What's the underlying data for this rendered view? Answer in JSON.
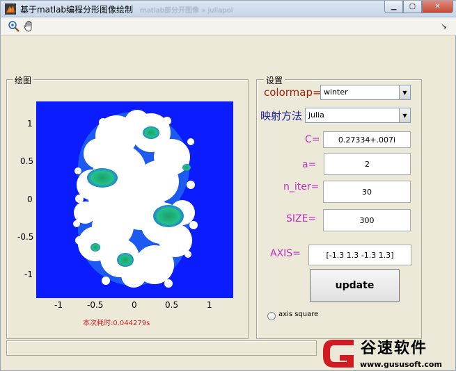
{
  "window": {
    "title": "基于matlab编程分形图像绘制",
    "title_ghost": "matlab部分开图像 » juliapol"
  },
  "toolbar": {
    "zoom_icon": "zoom-in-icon",
    "pan_icon": "pan-hand-icon",
    "dock_arrow": "↘"
  },
  "panels": {
    "plot_title": "绘图",
    "settings_title": "设置"
  },
  "plot": {
    "yticks": [
      "1",
      "0.5",
      "0",
      "-0.5",
      "-1"
    ],
    "xticks": [
      "-1",
      "-0.5",
      "0",
      "0.5",
      "1"
    ],
    "timing_text": "本次耗时:0.044279s"
  },
  "settings": {
    "colormap_label": "colormap=",
    "colormap_value": "winter",
    "mapping_label": "映射方法",
    "mapping_value": "julia",
    "c_label": "C=",
    "c_value": "0.27334+.007i",
    "a_label": "a=",
    "a_value": "2",
    "n_iter_label": "n_iter=",
    "n_iter_value": "30",
    "size_label": "SIZE=",
    "size_value": "300",
    "axis_label": "AXIS=",
    "axis_value": "[-1.3 1.3 -1.3 1.3]",
    "update_label": "update",
    "axis_square_label": "axis square"
  },
  "branding": {
    "name": "谷速软件",
    "url": "www.gususoft.com"
  },
  "colors": {
    "plot_background": "#0b1cff",
    "label_magenta": "#c030c0",
    "label_darkred": "#a02010",
    "label_blue": "#1a1aa0",
    "timing_red": "#d21e1e",
    "logo_red": "#d21a20"
  }
}
